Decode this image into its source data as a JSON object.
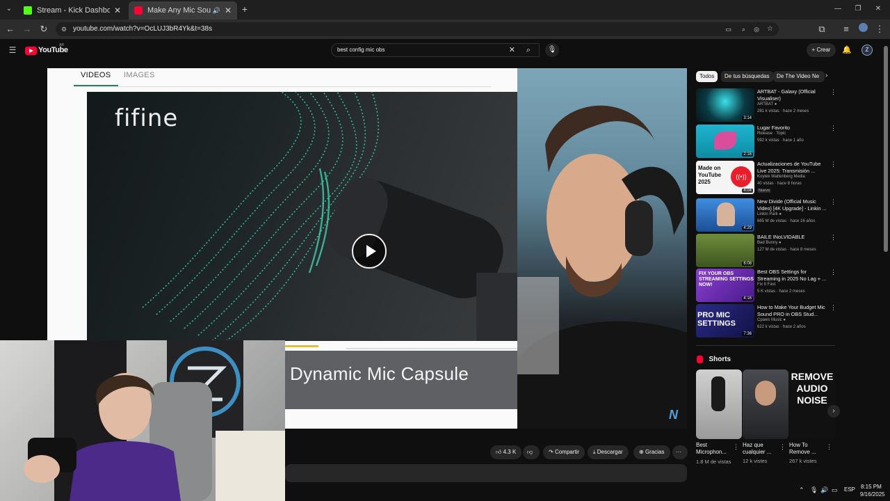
{
  "browser": {
    "tabs": [
      {
        "label": "Stream - Kick Dashboard",
        "active": false
      },
      {
        "label": "Make Any Mic Sound Exper",
        "active": true
      }
    ],
    "new_tab": "+",
    "url": "youtube.com/watch?v=OcLUJ3bR4Yk&t=38s",
    "window_controls": {
      "minimize": "—",
      "restore": "❐",
      "close": "✕"
    }
  },
  "youtube": {
    "logo_text": "YouTube",
    "region": "AR",
    "search_value": "best config mic obs",
    "create_label": "Crear",
    "avatar_letter": "Z"
  },
  "video": {
    "tabs": [
      "VIDEOS",
      "IMAGES"
    ],
    "brand_text": "fifine",
    "caption": "Dynamic Mic Capsule",
    "watermark": "N"
  },
  "actions": {
    "likes": "4.3 K",
    "share": "Compartir",
    "download": "Descargar",
    "thanks": "Gracias",
    "more": "···"
  },
  "sidebar": {
    "chips": [
      "Todos",
      "De tus búsquedas",
      "De The Video Ne"
    ],
    "recommendations": [
      {
        "title": "ARTBAT - Galaxy (Official Visualiser)",
        "channel": "ARTBAT",
        "meta": "281 k vistas · hace 2 meses",
        "duration": "3:14",
        "thumb": "#0d2f36",
        "nuevo": ""
      },
      {
        "title": "Lugar Favorito",
        "channel": "Release · Topic",
        "meta": "592 k vistas · hace 1 año",
        "duration": "2:16",
        "thumb": "#16a9c2",
        "nuevo": ""
      },
      {
        "title": "Actualizaciones de YouTube Live 2025: Transmisión ...",
        "channel": "Koytek Wattenberg Media",
        "meta": "40 vistas · hace 8 horas",
        "duration": "4:04",
        "thumb": "#f4f4f4",
        "nuevo": "Nuevo"
      },
      {
        "title": "New Divide (Official Music Video) [4K Upgrade] - Linkin ...",
        "channel": "Linkin Park",
        "meta": "665 M de vistas · hace 16 años",
        "duration": "4:29",
        "thumb": "#1f5fb0",
        "nuevo": ""
      },
      {
        "title": "BAILE INoLVIDABLE",
        "channel": "Bad Bunny",
        "meta": "127 M de vistas · hace 8 meses",
        "duration": "6:08",
        "thumb": "#4f6a2e",
        "nuevo": ""
      },
      {
        "title": "Best OBS Settings for Streaming in 2025 No Lag + ...",
        "channel": "Fix It Fast",
        "meta": "5 K vistas · hace 2 meses",
        "duration": "4:16",
        "thumb": "#6b2fae",
        "nuevo": ""
      },
      {
        "title": "How to Make Your Budget Mic Sound PRO in OBS Stud...",
        "channel": "Cpaws Music",
        "meta": "622 k vistas · hace 2 años",
        "duration": "7:36",
        "thumb": "#2a2a6b",
        "nuevo": ""
      }
    ],
    "shorts_label": "Shorts",
    "shorts": [
      {
        "title": "Best Microphon...",
        "views": "1.8 M de vistas",
        "bg": "#c8c8c8"
      },
      {
        "title": "Haz que cualquier ...",
        "views": "12 k vistes",
        "bg": "#3a3b40"
      },
      {
        "title": "How To Remove ...",
        "views": "267 k vistes",
        "bg": "#1a1a1a"
      }
    ],
    "short_overlay": "REMOVE AUDIO NOISE"
  },
  "taskbar": {
    "lang": "ESP",
    "time": "8:15 PM",
    "date": "9/16/2025"
  }
}
